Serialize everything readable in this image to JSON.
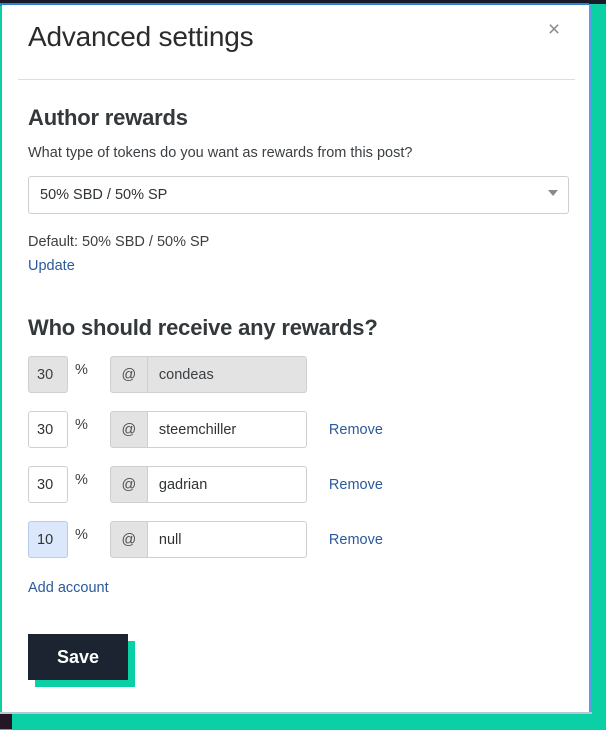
{
  "modal": {
    "title": "Advanced settings",
    "close_label": "×"
  },
  "author_rewards": {
    "heading": "Author rewards",
    "question": "What type of tokens do you want as rewards from this post?",
    "selected_option": "50% SBD / 50% SP",
    "options": [
      "50% SBD / 50% SP"
    ],
    "default_text": "Default: 50% SBD / 50% SP",
    "update_label": "Update"
  },
  "beneficiaries": {
    "heading": "Who should receive any rewards?",
    "percent_sign": "%",
    "at_sign": "@",
    "remove_label": "Remove",
    "add_account_label": "Add account",
    "rows": [
      {
        "percent": "30",
        "account": "condeas",
        "disabled": true,
        "focused": false,
        "removable": false
      },
      {
        "percent": "30",
        "account": "steemchiller",
        "disabled": false,
        "focused": false,
        "removable": true
      },
      {
        "percent": "30",
        "account": "gadrian",
        "disabled": false,
        "focused": false,
        "removable": true
      },
      {
        "percent": "10",
        "account": "null",
        "disabled": false,
        "focused": true,
        "removable": true
      }
    ]
  },
  "footer": {
    "save_label": "Save"
  },
  "colors": {
    "accent_teal": "#0bd0a5",
    "link_blue": "#2b5a9b",
    "save_dark": "#1b2430",
    "border_blue": "#5d9bea"
  }
}
